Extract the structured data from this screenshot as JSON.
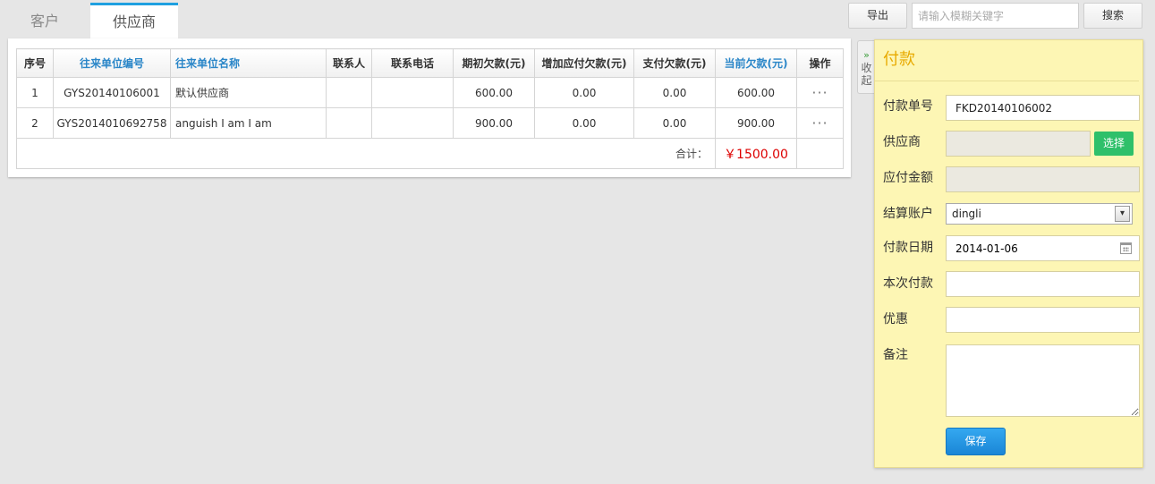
{
  "tabs": [
    {
      "label": "客户",
      "active": false
    },
    {
      "label": "供应商",
      "active": true
    }
  ],
  "toolbar": {
    "export_label": "导出",
    "search_placeholder": "请输入模糊关键字",
    "search_label": "搜索"
  },
  "table": {
    "headers": {
      "no": "序号",
      "code": "往来单位编号",
      "name": "往来单位名称",
      "contact": "联系人",
      "phone": "联系电话",
      "opening_debt": "期初欠款(元)",
      "added_payable": "增加应付欠款(元)",
      "paid_debt": "支付欠款(元)",
      "current_debt": "当前欠款(元)",
      "actions": "操作"
    },
    "rows": [
      {
        "no": "1",
        "code": "GYS20140106001",
        "name": "默认供应商",
        "contact": "",
        "phone": "",
        "opening_debt": "600.00",
        "added_payable": "0.00",
        "paid_debt": "0.00",
        "current_debt": "600.00",
        "actions": "···"
      },
      {
        "no": "2",
        "code": "GYS2014010692758",
        "name": "anguish I am I am",
        "contact": "",
        "phone": "",
        "opening_debt": "900.00",
        "added_payable": "0.00",
        "paid_debt": "0.00",
        "current_debt": "900.00",
        "actions": "···"
      }
    ],
    "total_label": "合计：",
    "total_value": "￥1500.00"
  },
  "collapse": {
    "chevron": "»",
    "label_line1": "收",
    "label_line2": "起"
  },
  "payment_form": {
    "title": "付款",
    "fields": {
      "payment_no": {
        "label": "付款单号",
        "value": "FKD20140106002"
      },
      "supplier": {
        "label": "供应商",
        "value": ""
      },
      "choose_label": "选择",
      "payable_amount": {
        "label": "应付金额",
        "value": ""
      },
      "account": {
        "label": "结算账户",
        "value": "dingli"
      },
      "date": {
        "label": "付款日期",
        "value": "2014-01-06"
      },
      "this_payment": {
        "label": "本次付款",
        "value": ""
      },
      "discount": {
        "label": "优惠",
        "value": ""
      },
      "remark": {
        "label": "备注",
        "value": ""
      }
    },
    "save_label": "保存"
  },
  "colors": {
    "accent_blue": "#1fa0e0",
    "link_blue": "#2a86c8",
    "total_red": "#dd0000",
    "form_bg": "#fdf6b4",
    "form_title": "#e8aa00",
    "choose_green": "#2ec06a",
    "save_blue": "#1a86d6"
  }
}
